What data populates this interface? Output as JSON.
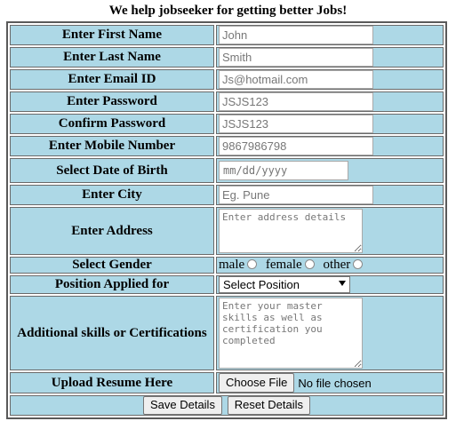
{
  "page": {
    "title": "We help jobseeker for getting better Jobs!"
  },
  "form": {
    "first_name": {
      "label": "Enter First Name",
      "placeholder": "John"
    },
    "last_name": {
      "label": "Enter Last Name",
      "placeholder": "Smith"
    },
    "email": {
      "label": "Enter Email ID",
      "placeholder": "Js@hotmail.com"
    },
    "password": {
      "label": "Enter Password",
      "placeholder": "JSJS123"
    },
    "confirm_password": {
      "label": "Confirm Password",
      "placeholder": "JSJS123"
    },
    "mobile": {
      "label": "Enter Mobile Number",
      "placeholder": "9867986798"
    },
    "dob": {
      "label": "Select Date of Birth",
      "placeholder": "mm/dd/yyyy"
    },
    "city": {
      "label": "Enter City",
      "placeholder": "Eg. Pune"
    },
    "address": {
      "label": "Enter Address",
      "placeholder": "Enter address details"
    },
    "gender": {
      "label": "Select Gender",
      "options": [
        "male",
        "female",
        "other"
      ]
    },
    "position": {
      "label": "Position Applied for",
      "selected": "Select Position"
    },
    "skills": {
      "label": "Additional skills or Certifications",
      "placeholder": "Enter your master skills as well as certification you completed"
    },
    "resume": {
      "label": "Upload Resume Here",
      "button_label": "Choose File",
      "status": "No file chosen"
    },
    "actions": {
      "save_label": "Save Details",
      "reset_label": "Reset Details"
    }
  },
  "colors": {
    "cell_background": "#add8e6",
    "border": "#5a5a5a"
  }
}
